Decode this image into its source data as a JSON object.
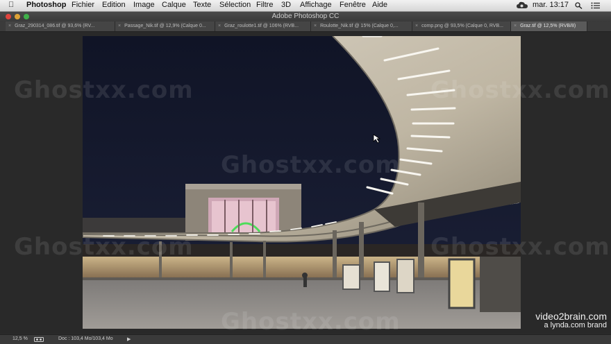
{
  "menubar": {
    "app": "Photoshop",
    "items": [
      "Fichier",
      "Edition",
      "Image",
      "Calque",
      "Texte",
      "Sélection",
      "Filtre",
      "3D",
      "Affichage",
      "Fenêtre",
      "Aide"
    ],
    "clock": "mar. 13:17"
  },
  "window": {
    "title": "Adobe Photoshop CC"
  },
  "tabs": [
    {
      "label": "Graz_290314_086.tif @ 93,6% (RV...",
      "active": false
    },
    {
      "label": "Passage_Nik.tif @ 12,9% (Calque 0...",
      "active": false
    },
    {
      "label": "Graz_roulotte1.tif @ 106% (RVB...",
      "active": false
    },
    {
      "label": "Roulotte_Nik.tif @ 15% (Calque 0,...",
      "active": false
    },
    {
      "label": "comp.png @ 93,5% (Calque 0, RVB...",
      "active": false
    },
    {
      "label": "Graz.tif @ 12,5% (RVB/8)",
      "active": true
    }
  ],
  "watermark": "Ghostxx.com",
  "brand": {
    "line1": "video2brain.com",
    "line2": "a lynda.com brand"
  },
  "status": {
    "zoom": "12,5 %",
    "doc": "Doc : 103,4 Mo/103,4 Mo"
  },
  "colors": {
    "menubar": "#e4e4e4",
    "workspace": "#292929",
    "tab_active": "#5a5a5a",
    "night_sky": "#141828"
  }
}
